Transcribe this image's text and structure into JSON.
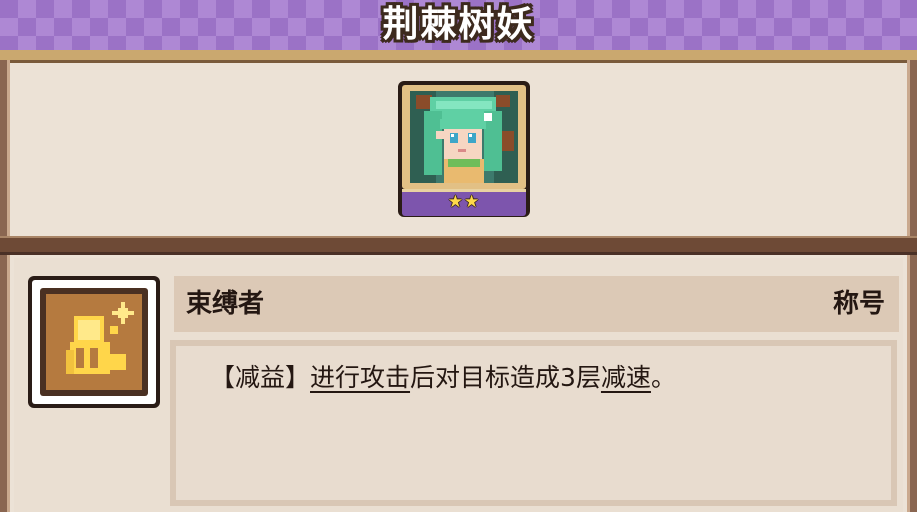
{
  "title": "荆棘树妖",
  "portrait": {
    "icon": "dryad-portrait-icon",
    "stars": "★★"
  },
  "trait": {
    "icon": "bound-figure-icon",
    "name": "束缚者",
    "category": "称号",
    "description": {
      "prefix": "【减益】",
      "keyword1": "进行攻击",
      "middle": "后对目标造成3层",
      "keyword2": "减速",
      "suffix": "。"
    }
  },
  "colors": {
    "banner": "#9b72c6",
    "banner_border": "#6b4c93",
    "frame": "#8a6651",
    "panel": "#ece2d6",
    "star": "#ffd94a",
    "trait_icon_bg": "#b57a3f"
  }
}
